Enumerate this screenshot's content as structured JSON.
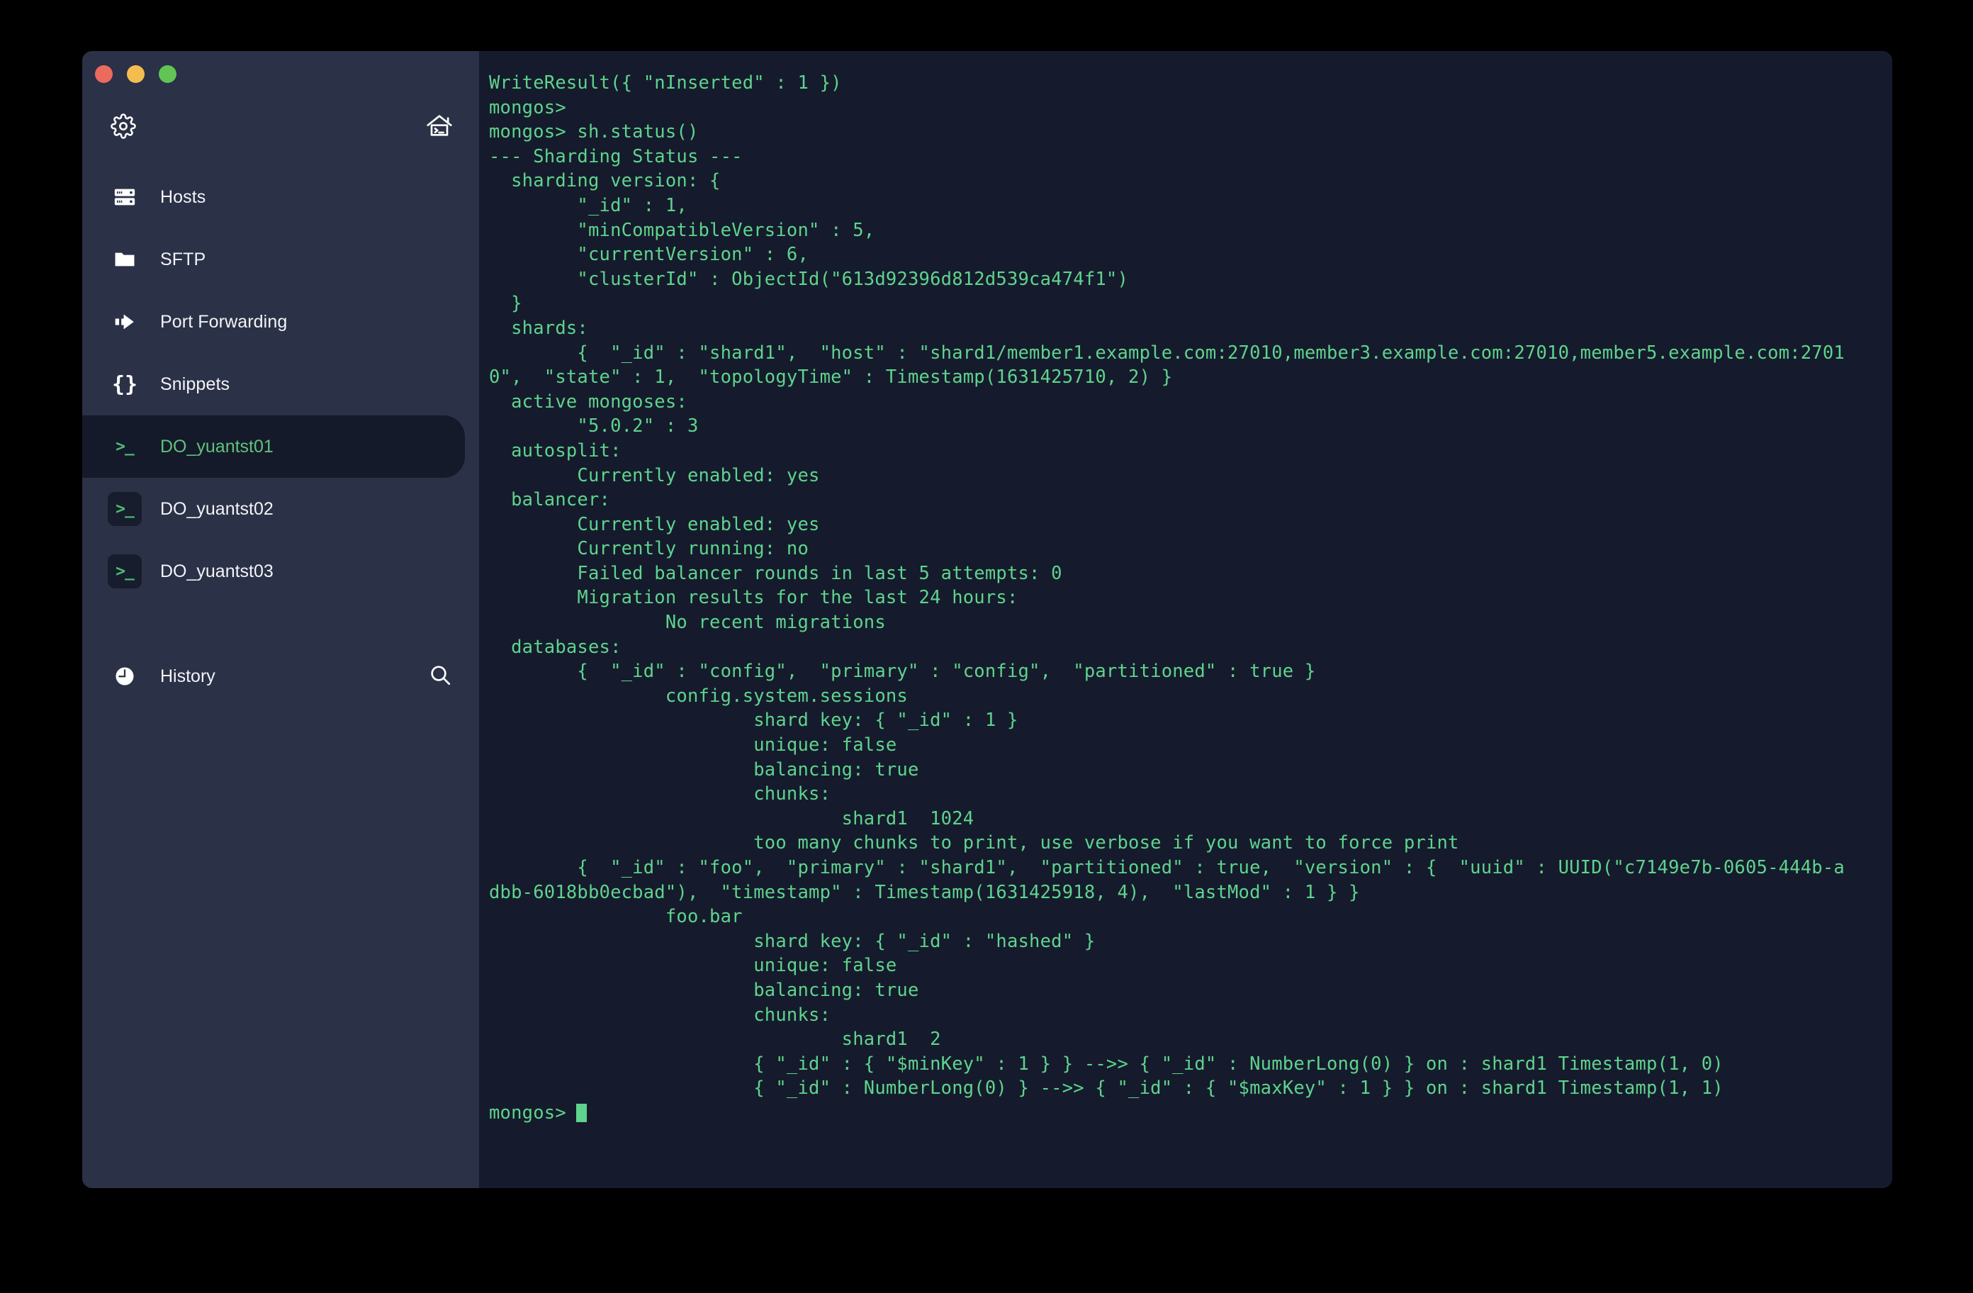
{
  "window": {
    "traffic_lights": [
      {
        "name": "close",
        "color": "#ed6a5e"
      },
      {
        "name": "minimize",
        "color": "#f5bd4f"
      },
      {
        "name": "zoom",
        "color": "#61c454"
      }
    ]
  },
  "sidebar": {
    "top_actions": [
      {
        "name": "settings",
        "icon": "gear-icon"
      },
      {
        "name": "home",
        "icon": "home-terminal-icon"
      }
    ],
    "nav": [
      {
        "label": "Hosts",
        "icon": "server-icon"
      },
      {
        "label": "SFTP",
        "icon": "folder-icon"
      },
      {
        "label": "Port Forwarding",
        "icon": "forward-arrow-icon"
      },
      {
        "label": "Snippets",
        "icon": "braces-icon"
      }
    ],
    "sessions": [
      {
        "label": "DO_yuantst01",
        "icon": "terminal-prompt-icon",
        "active": true
      },
      {
        "label": "DO_yuantst02",
        "icon": "terminal-prompt-icon",
        "active": false
      },
      {
        "label": "DO_yuantst03",
        "icon": "terminal-prompt-icon",
        "active": false
      }
    ],
    "history": {
      "label": "History",
      "icon": "clock-icon",
      "search_icon": "search-icon"
    }
  },
  "terminal": {
    "prompt": "mongos>",
    "cursor_color": "#5fd38d",
    "text_color": "#5fd38d",
    "background": "#151b2c",
    "lines": [
      "WriteResult({ \"nInserted\" : 1 })",
      "mongos>",
      "mongos> sh.status()",
      "--- Sharding Status --- ",
      "  sharding version: {",
      "        \"_id\" : 1,",
      "        \"minCompatibleVersion\" : 5,",
      "        \"currentVersion\" : 6,",
      "        \"clusterId\" : ObjectId(\"613d92396d812d539ca474f1\")",
      "  }",
      "  shards:",
      "        {  \"_id\" : \"shard1\",  \"host\" : \"shard1/member1.example.com:27010,member3.example.com:27010,member5.example.com:2701",
      "0\",  \"state\" : 1,  \"topologyTime\" : Timestamp(1631425710, 2) }",
      "  active mongoses:",
      "        \"5.0.2\" : 3",
      "  autosplit:",
      "        Currently enabled: yes",
      "  balancer:",
      "        Currently enabled: yes",
      "        Currently running: no",
      "        Failed balancer rounds in last 5 attempts: 0",
      "        Migration results for the last 24 hours:",
      "                No recent migrations",
      "  databases:",
      "        {  \"_id\" : \"config\",  \"primary\" : \"config\",  \"partitioned\" : true }",
      "                config.system.sessions",
      "                        shard key: { \"_id\" : 1 }",
      "                        unique: false",
      "                        balancing: true",
      "                        chunks:",
      "                                shard1  1024",
      "                        too many chunks to print, use verbose if you want to force print",
      "        {  \"_id\" : \"foo\",  \"primary\" : \"shard1\",  \"partitioned\" : true,  \"version\" : {  \"uuid\" : UUID(\"c7149e7b-0605-444b-a",
      "dbb-6018bb0ecbad\"),  \"timestamp\" : Timestamp(1631425918, 4),  \"lastMod\" : 1 } }",
      "                foo.bar",
      "                        shard key: { \"_id\" : \"hashed\" }",
      "                        unique: false",
      "                        balancing: true",
      "                        chunks:",
      "                                shard1  2",
      "                        { \"_id\" : { \"$minKey\" : 1 } } -->> { \"_id\" : NumberLong(0) } on : shard1 Timestamp(1, 0) ",
      "                        { \"_id\" : NumberLong(0) } -->> { \"_id\" : { \"$maxKey\" : 1 } } on : shard1 Timestamp(1, 1) "
    ]
  }
}
